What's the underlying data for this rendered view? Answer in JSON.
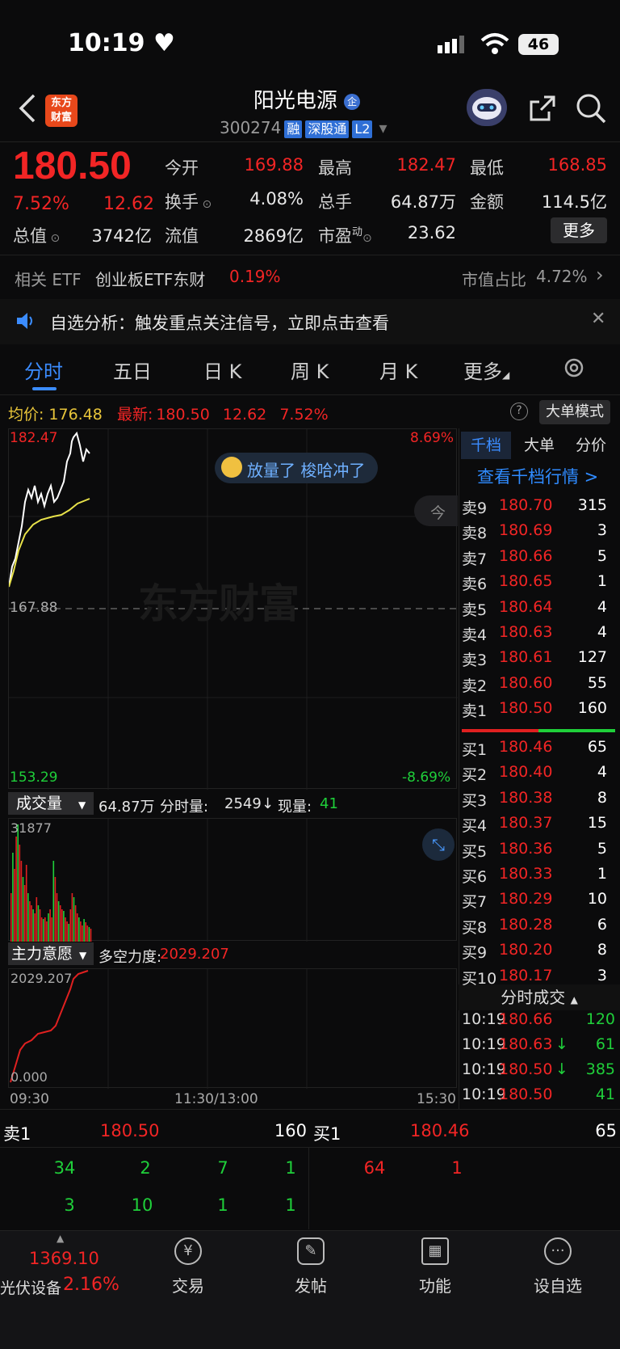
{
  "status_bar": {
    "time": "10:19",
    "battery": "46"
  },
  "header": {
    "logo_line1": "东方",
    "logo_line2": "财富",
    "stock_name": "阳光电源",
    "stock_code": "300274",
    "tags": [
      "融",
      "深股通",
      "L2"
    ]
  },
  "quote": {
    "price": "180.50",
    "change_pct": "7.52%",
    "change_amt": "12.62",
    "open_label": "今开",
    "open": "169.88",
    "high_label": "最高",
    "high": "182.47",
    "low_label": "最低",
    "low": "168.85",
    "turnover_label": "换手",
    "turnover": "4.08%",
    "volume_label": "总手",
    "volume": "64.87万",
    "amount_label": "金额",
    "amount": "114.5亿",
    "mktcap_label": "总值",
    "mktcap": "3742亿",
    "float_label": "流值",
    "float": "2869亿",
    "pe_label": "市盈",
    "pe_sup": "动",
    "pe": "23.62",
    "more": "更多"
  },
  "etf": {
    "label": "相关 ETF",
    "name": "创业板ETF东财",
    "pct": "0.19%",
    "ratio_label": "市值占比",
    "ratio": "4.72%"
  },
  "notice": {
    "text": "自选分析：触发重点关注信号，立即点击查看"
  },
  "tabs": [
    "分时",
    "五日",
    "日 K",
    "周 K",
    "月 K",
    "更多"
  ],
  "chart": {
    "avg_label": "均价:",
    "avg": "176.48",
    "latest_label": "最新:",
    "latest": "180.50",
    "latest_chg": "12.62",
    "latest_pct": "7.52%",
    "mode_btn": "大单模式",
    "y_top": "182.47",
    "y_mid": "167.88",
    "y_bot": "153.29",
    "pct_top": "8.69%",
    "pct_bot": "-8.69%",
    "watermark": "东方财富",
    "chip": "放量了 梭哈冲了",
    "today": "今天",
    "vol_tab": "成交量",
    "vol_total": "64.87万",
    "vol_min_label": "分时量:",
    "vol_min": "2549",
    "vol_now_label": "现量:",
    "vol_now": "41",
    "vol_max": "31877",
    "ind_tab": "主力意愿",
    "ind_label": "多空力度:",
    "ind_val": "2029.207",
    "ind_top": "2029.207",
    "ind_bot": "0.000",
    "x_start": "09:30",
    "x_mid": "11:30/13:00",
    "x_end": "15:30"
  },
  "orderbook": {
    "tabs": [
      "千档",
      "大单",
      "分价"
    ],
    "link": "查看千档行情 >",
    "asks": [
      {
        "label": "卖9",
        "price": "180.70",
        "vol": "315"
      },
      {
        "label": "卖8",
        "price": "180.69",
        "vol": "3"
      },
      {
        "label": "卖7",
        "price": "180.66",
        "vol": "5"
      },
      {
        "label": "卖6",
        "price": "180.65",
        "vol": "1"
      },
      {
        "label": "卖5",
        "price": "180.64",
        "vol": "4"
      },
      {
        "label": "卖4",
        "price": "180.63",
        "vol": "4"
      },
      {
        "label": "卖3",
        "price": "180.61",
        "vol": "127"
      },
      {
        "label": "卖2",
        "price": "180.60",
        "vol": "55"
      },
      {
        "label": "卖1",
        "price": "180.50",
        "vol": "160"
      }
    ],
    "bids": [
      {
        "label": "买1",
        "price": "180.46",
        "vol": "65"
      },
      {
        "label": "买2",
        "price": "180.40",
        "vol": "4"
      },
      {
        "label": "买3",
        "price": "180.38",
        "vol": "8"
      },
      {
        "label": "买4",
        "price": "180.37",
        "vol": "15"
      },
      {
        "label": "买5",
        "price": "180.36",
        "vol": "5"
      },
      {
        "label": "买6",
        "price": "180.33",
        "vol": "1"
      },
      {
        "label": "买7",
        "price": "180.29",
        "vol": "10"
      },
      {
        "label": "买8",
        "price": "180.28",
        "vol": "6"
      },
      {
        "label": "买9",
        "price": "180.20",
        "vol": "8"
      },
      {
        "label": "买10",
        "price": "180.17",
        "vol": "3"
      }
    ],
    "ticks_title": "分时成交",
    "ticks": [
      {
        "time": "10:19",
        "price": "180.66",
        "arrow": "",
        "vol": "120"
      },
      {
        "time": "10:19",
        "price": "180.63",
        "arrow": "↓",
        "vol": "61"
      },
      {
        "time": "10:19",
        "price": "180.50",
        "arrow": "↓",
        "vol": "385"
      },
      {
        "time": "10:19",
        "price": "180.50",
        "arrow": "",
        "vol": "41"
      }
    ]
  },
  "queue": {
    "sell_label": "卖1",
    "sell_price": "180.50",
    "sell_vol": "160",
    "buy_label": "买1",
    "buy_price": "180.46",
    "buy_vol": "65",
    "sell_row1": [
      "34",
      "2",
      "7",
      "1"
    ],
    "sell_row2": [
      "3",
      "10",
      "1",
      "1"
    ],
    "buy_row1": [
      "64",
      "1"
    ]
  },
  "bottom_nav": {
    "index_val": "1369.10",
    "index_name": "光伏设备",
    "index_pct": "2.16%",
    "items": [
      "交易",
      "发帖",
      "功能",
      "设自选"
    ]
  }
}
